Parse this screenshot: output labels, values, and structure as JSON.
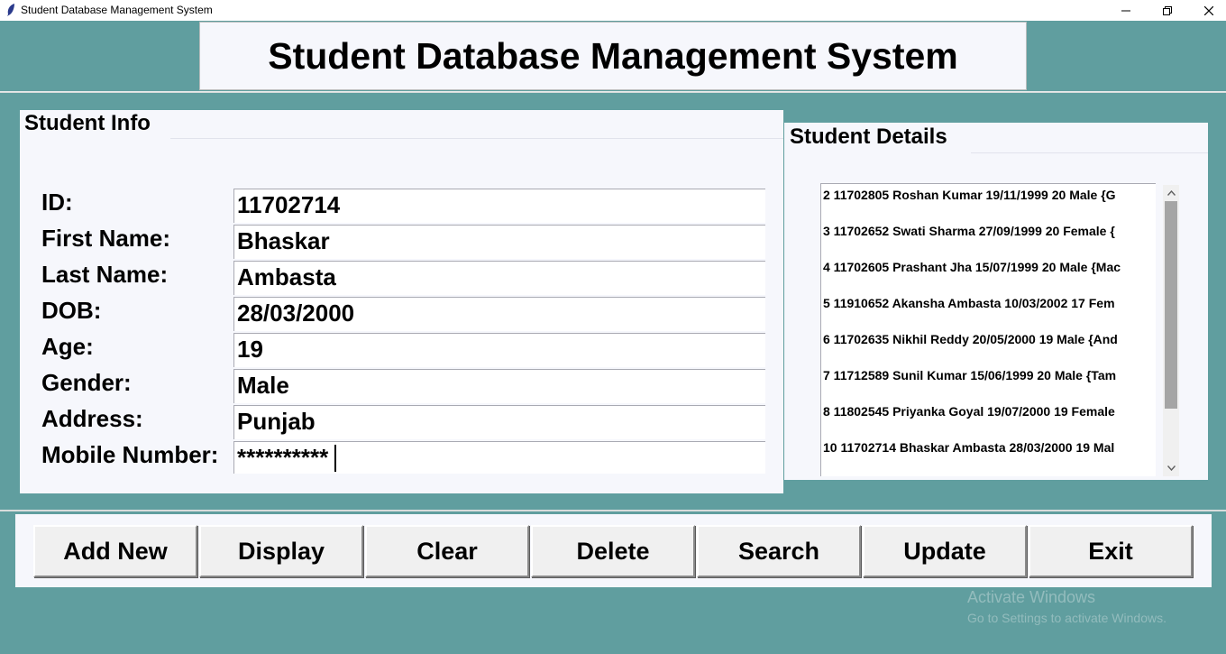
{
  "window": {
    "title": "Student Database Management System",
    "icons": [
      "feather-icon",
      "minimize-icon",
      "maximize-icon",
      "close-icon"
    ]
  },
  "header": {
    "title": "Student Database Management System"
  },
  "student_info": {
    "title": "Student Info",
    "fields": [
      {
        "label": "ID:",
        "value": "11702714"
      },
      {
        "label": "First Name:",
        "value": "Bhaskar"
      },
      {
        "label": "Last Name:",
        "value": "Ambasta"
      },
      {
        "label": "DOB:",
        "value": "28/03/2000"
      },
      {
        "label": "Age:",
        "value": "19"
      },
      {
        "label": "Gender:",
        "value": "Male"
      },
      {
        "label": "Address:",
        "value": "Punjab"
      },
      {
        "label": "Mobile Number:",
        "value": "**********"
      }
    ]
  },
  "student_details": {
    "title": "Student Details",
    "rows": [
      "2 11702805 Roshan Kumar 19/11/1999 20 Male {G",
      "3 11702652 Swati Sharma 27/09/1999 20 Female {",
      "4 11702605 Prashant Jha 15/07/1999 20 Male {Mac",
      "5 11910652 Akansha Ambasta 10/03/2002 17 Fem",
      "6 11702635 Nikhil Reddy 20/05/2000 19 Male {And",
      "7 11712589 Sunil Kumar 15/06/1999 20 Male {Tam",
      "8 11802545 Priyanka Goyal 19/07/2000 19 Female",
      "10 11702714 Bhaskar Ambasta 28/03/2000 19 Mal"
    ]
  },
  "buttons": {
    "add_new": "Add New",
    "display": "Display",
    "clear": "Clear",
    "delete": "Delete",
    "search": "Search",
    "update": "Update",
    "exit": "Exit"
  },
  "watermark": {
    "line1": "Activate Windows",
    "line2": "Go to Settings to activate Windows."
  },
  "colors": {
    "background": "#609e9f",
    "panel": "#f6f7fc",
    "button": "#f0f0f0"
  }
}
